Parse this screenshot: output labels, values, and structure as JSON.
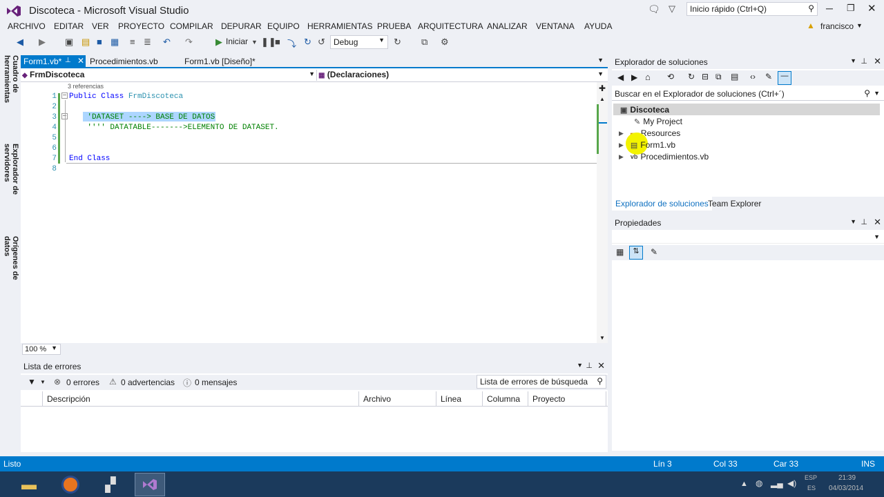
{
  "window": {
    "title": "Discoteca - Microsoft Visual Studio",
    "quick_launch_placeholder": "Inicio rápido (Ctrl+Q)",
    "user": "francisco"
  },
  "menu": [
    "ARCHIVO",
    "EDITAR",
    "VER",
    "PROYECTO",
    "COMPILAR",
    "DEPURAR",
    "EQUIPO",
    "HERRAMIENTAS",
    "PRUEBA",
    "ARQUITECTURA",
    "ANALIZAR",
    "VENTANA",
    "AYUDA"
  ],
  "toolbar": {
    "start_label": "Iniciar",
    "config": "Debug"
  },
  "left_tabs": [
    "Cuadro de herramientas",
    "Explorador de servidores",
    "Orígenes de datos"
  ],
  "doc_tabs": [
    "Form1.vb*",
    "Procedimientos.vb",
    "Form1.vb [Diseño]*"
  ],
  "navbar": {
    "class_combo": "FrmDiscoteca",
    "member_combo": "(Declaraciones)"
  },
  "editor": {
    "references_hint": "3 referencias",
    "lines": [
      {
        "n": "1",
        "text": "Public Class FrmDiscoteca"
      },
      {
        "n": "2",
        "text": ""
      },
      {
        "n": "3",
        "text": "    'DATASET ----> BASE DE DATOS"
      },
      {
        "n": "4",
        "text": "    '''' DATATABLE------->ELEMENTO DE DATASET."
      },
      {
        "n": "5",
        "text": ""
      },
      {
        "n": "6",
        "text": ""
      },
      {
        "n": "7",
        "text": "End Class"
      },
      {
        "n": "8",
        "text": ""
      }
    ],
    "zoom": "100 %"
  },
  "error_list": {
    "title": "Lista de errores",
    "errors": "0 errores",
    "warnings": "0 advertencias",
    "messages": "0 mensajes",
    "search_placeholder": "Lista de errores de búsqueda",
    "columns": [
      "Descripción",
      "Archivo",
      "Línea",
      "Columna",
      "Proyecto"
    ]
  },
  "solution_explorer": {
    "title": "Explorador de soluciones",
    "search_placeholder": "Buscar en el Explorador de soluciones (Ctrl+´)",
    "items": [
      "Discoteca",
      "My Project",
      "Resources",
      "Form1.vb",
      "Procedimientos.vb"
    ],
    "bottom_tabs": [
      "Explorador de soluciones",
      "Team Explorer"
    ]
  },
  "properties": {
    "title": "Propiedades"
  },
  "status": {
    "left": "Listo",
    "line": "Lín 3",
    "col": "Col 33",
    "car": "Car 33",
    "mode": "INS"
  },
  "taskbar": {
    "lang": "ESP",
    "region": "ES",
    "time": "21:39",
    "date": "04/03/2014"
  },
  "colors": {
    "accent": "#007acc",
    "vs_purple": "#68217a"
  }
}
